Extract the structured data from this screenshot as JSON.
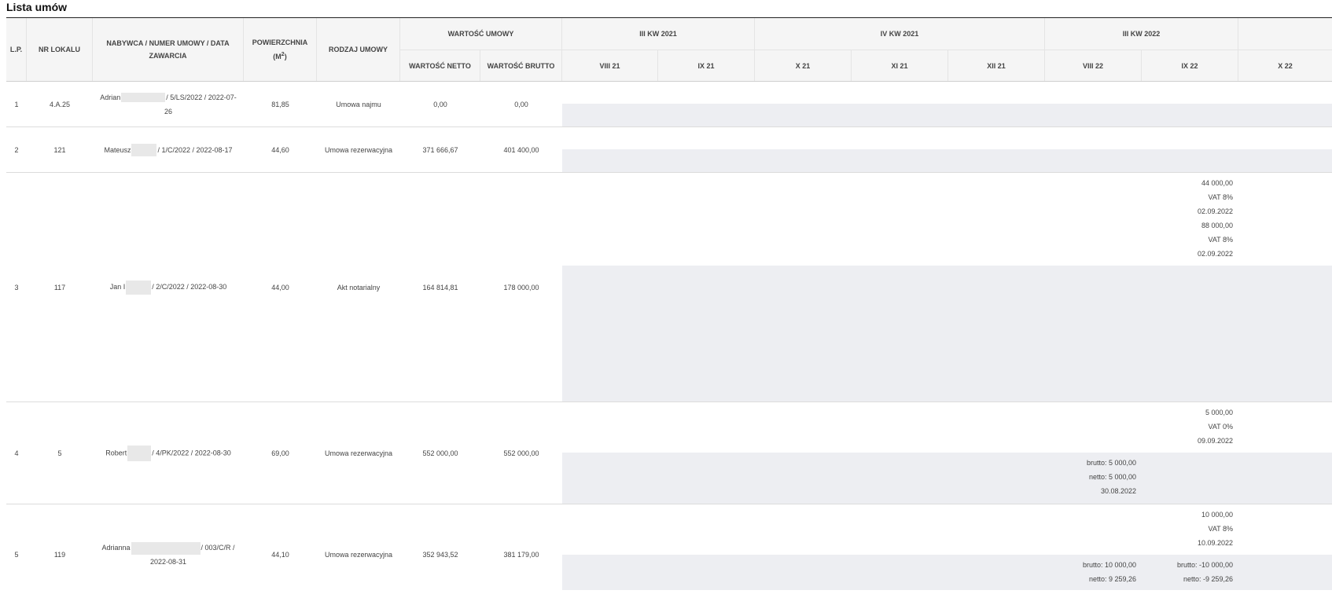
{
  "page": {
    "title": "Lista umów"
  },
  "header": {
    "lp": "L.P.",
    "nr_lokalu": "NR LOKALU",
    "nabywca": "NABYWCA / NUMER UMOWY / DATA ZAWARCIA",
    "powierzchnia": "POWIERZCHNIA (M",
    "powierzchnia_sup": "2",
    "powierzchnia_end": ")",
    "rodzaj": "RODZAJ UMOWY",
    "wartosc_group": "WARTOŚĆ UMOWY",
    "wartosc_netto": "WARTOŚĆ NETTO",
    "wartosc_brutto": "WARTOŚĆ BRUTTO",
    "quarters": [
      "III KW 2021",
      "IV KW 2021",
      "III KW 2022"
    ],
    "months": [
      "VIII 21",
      "IX 21",
      "X 21",
      "XI 21",
      "XII 21",
      "VIII 22",
      "IX 22",
      "X 22"
    ]
  },
  "rows": [
    {
      "lp": "1",
      "nr": "4.A.25",
      "nabywca_a": "Adrian",
      "nabywca_b": "/ 5/LS/2022 / 2022-07-",
      "nabywca_c": "26",
      "pow": "81,85",
      "rodzaj": "Umowa najmu",
      "netto": "0,00",
      "brutto": "0,00"
    },
    {
      "lp": "2",
      "nr": "121",
      "nabywca_a": "Mateusz",
      "nabywca_b": "/ 1/C/2022 / 2022-08-17",
      "pow": "44,60",
      "rodzaj": "Umowa rezerwacyjna",
      "netto": "371 666,67",
      "brutto": "401 400,00"
    },
    {
      "lp": "3",
      "nr": "117",
      "nabywca_a": "Jan I",
      "nabywca_b": "/ 2/C/2022 / 2022-08-30",
      "pow": "44,00",
      "rodzaj": "Akt notarialny",
      "netto": "164 814,81",
      "brutto": "178 000,00",
      "plan_ix22": [
        "44 000,00",
        "VAT 8%",
        "02.09.2022",
        "88 000,00",
        "VAT 8%",
        "02.09.2022"
      ]
    },
    {
      "lp": "4",
      "nr": "5",
      "nabywca_a": "Robert",
      "nabywca_b": "/ 4/PK/2022 / 2022-08-30",
      "pow": "69,00",
      "rodzaj": "Umowa rezerwacyjna",
      "netto": "552 000,00",
      "brutto": "552 000,00",
      "plan_ix22": [
        "5 000,00",
        "VAT 0%",
        "09.09.2022"
      ],
      "paid_viii22": [
        "brutto: 5 000,00",
        "netto: 5 000,00",
        "30.08.2022"
      ]
    },
    {
      "lp": "5",
      "nr": "119",
      "nabywca_a": "Adrianna",
      "nabywca_b": "/ 003/C/R /",
      "nabywca_c": "2022-08-31",
      "pow": "44,10",
      "rodzaj": "Umowa rezerwacyjna",
      "netto": "352 943,52",
      "brutto": "381 179,00",
      "plan_ix22": [
        "10 000,00",
        "VAT 8%",
        "10.09.2022"
      ],
      "paid_viii22": [
        "brutto: 10 000,00",
        "netto: 9 259,26"
      ],
      "paid_ix22": [
        "brutto: -10 000,00",
        "netto: -9 259,26"
      ]
    }
  ],
  "colors": {
    "header_bg": "#f5f5f5",
    "band_bg": "#edeef2",
    "border": "#e4e4e4",
    "title_rule": "#222222"
  }
}
